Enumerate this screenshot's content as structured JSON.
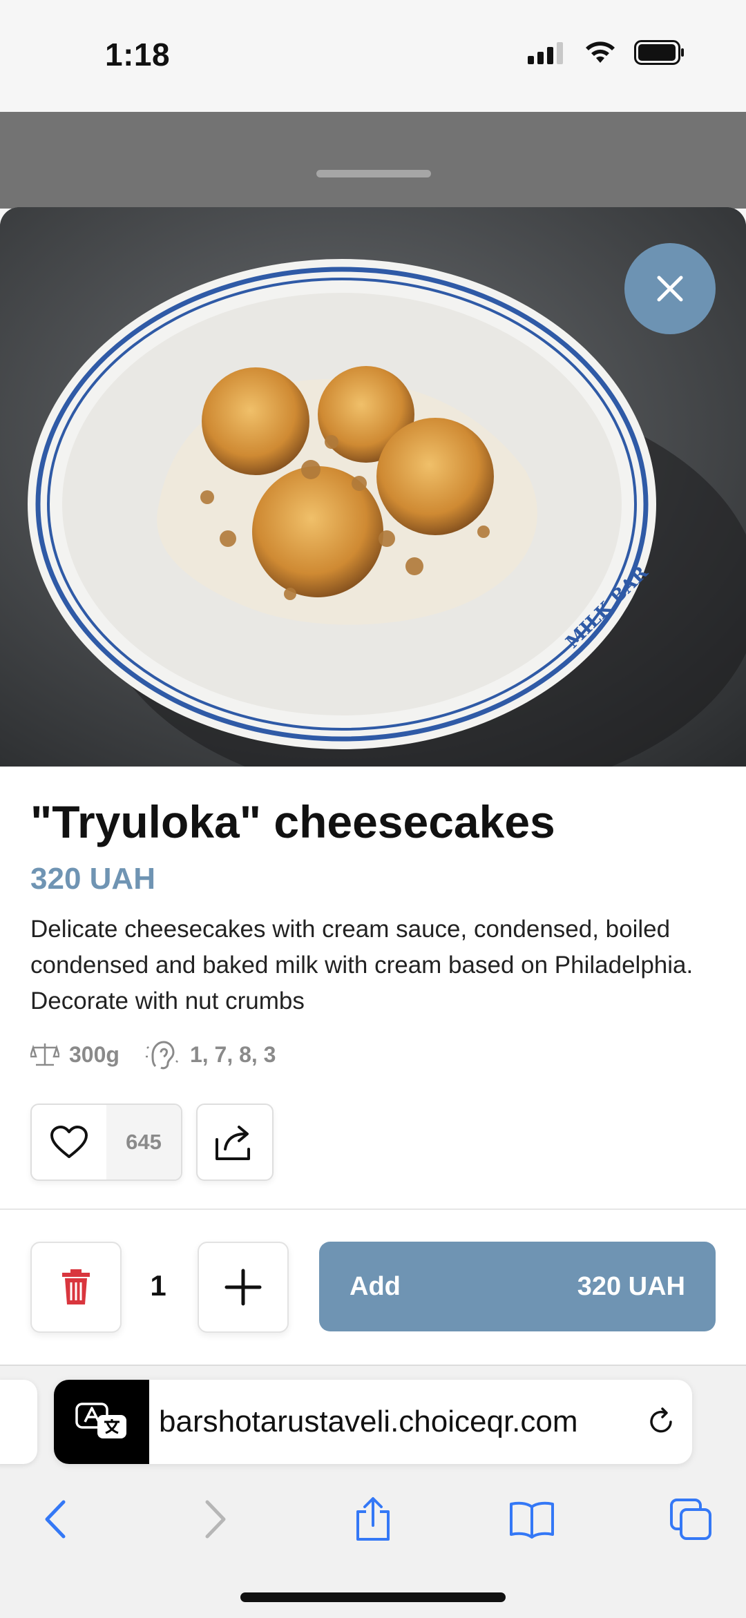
{
  "status_bar": {
    "time": "1:18",
    "icons": [
      "cellular-icon",
      "wifi-icon",
      "battery-icon"
    ]
  },
  "product": {
    "title": "\"Tryuloka\" cheesecakes",
    "price": "320 UAH",
    "description": "Delicate cheesecakes with cream sauce, condensed, boiled condensed and baked milk with cream based on Philadelphia. Decorate with nut crumbs",
    "weight": "300g",
    "allergens": "1, 7, 8, 3",
    "likes": "645",
    "plate_brand": "MILK BAR"
  },
  "cart": {
    "quantity": "1",
    "add_label": "Add",
    "add_price": "320 UAH"
  },
  "browser": {
    "url": "barshotarustaveli.choiceqr.com"
  },
  "colors": {
    "accent": "#6f94b3",
    "trash": "#d9363e"
  }
}
